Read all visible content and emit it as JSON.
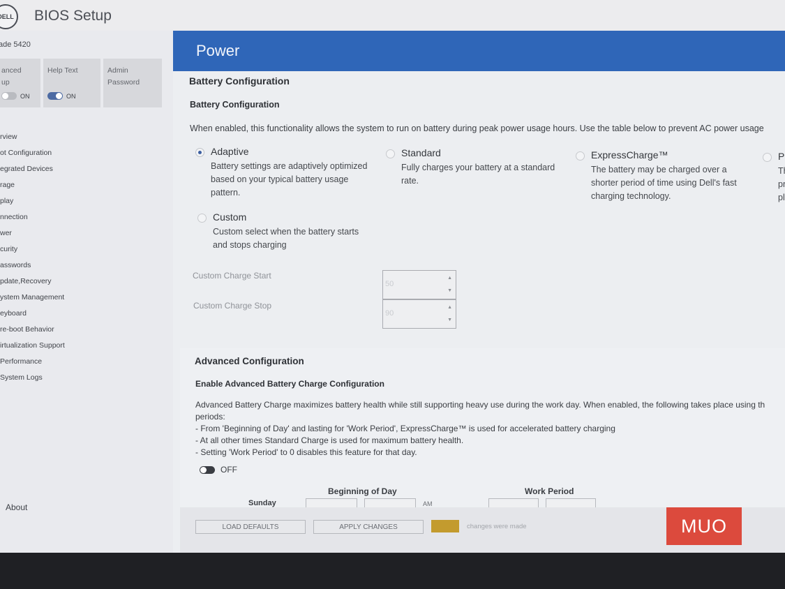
{
  "app": {
    "logo_text": "DELL",
    "title": "BIOS Setup",
    "model": "ade 5420"
  },
  "quick_settings": [
    {
      "label_lines": [
        "anced",
        "up"
      ],
      "toggle": "ON",
      "on": false
    },
    {
      "label_lines": [
        "Help Text",
        ""
      ],
      "toggle": "ON",
      "on": true
    },
    {
      "label_lines": [
        "Admin",
        "Password"
      ],
      "toggle": "",
      "on": false
    }
  ],
  "nav": [
    "rview",
    "ot Configuration",
    "egrated Devices",
    "rage",
    "play",
    "nnection",
    "wer",
    "curity",
    "asswords",
    "pdate,Recovery",
    "ystem Management",
    "eyboard",
    "re-boot Behavior",
    "irtualization Support",
    "Performance",
    "System Logs"
  ],
  "about": "About",
  "page": {
    "title": "Power"
  },
  "battery": {
    "section_title": "Battery Configuration",
    "sub_title": "Battery Configuration",
    "description": "When enabled, this functionality allows the system to run on battery during peak power usage hours. Use the table below to prevent AC power usage",
    "options": [
      {
        "name": "Adaptive",
        "desc": [
          "Battery settings are adaptively optimized",
          "based on your typical battery usage",
          "pattern."
        ],
        "selected": true
      },
      {
        "name": "Standard",
        "desc": [
          "Fully charges your battery at a standard",
          "rate."
        ],
        "selected": false
      },
      {
        "name": "ExpressCharge™",
        "desc": [
          "The battery may be charged over a",
          "shorter period of time using Dell's fast",
          "charging technology."
        ],
        "selected": false
      },
      {
        "name": "P",
        "desc": [
          "Th",
          "pr",
          "pl"
        ],
        "selected": false
      },
      {
        "name": "Custom",
        "desc": [
          "Custom select when the battery starts",
          "and stops charging"
        ],
        "selected": false
      }
    ],
    "custom_start_label": "Custom Charge Start",
    "custom_start_value": "50",
    "custom_stop_label": "Custom Charge Stop",
    "custom_stop_value": "90"
  },
  "advanced": {
    "section_title": "Advanced Configuration",
    "sub_title": "Enable Advanced Battery Charge Configuration",
    "description_lines": [
      "Advanced Battery Charge maximizes battery health while still supporting heavy use during the work day. When enabled, the following takes place using th",
      "periods:",
      "- From 'Beginning of Day' and lasting for 'Work Period', ExpressCharge™ is used for accelerated battery charging",
      "- At all other times Standard Charge is used for maximum battery health.",
      "- Setting 'Work Period' to 0 disables this feature for that day."
    ],
    "toggle_label": "OFF",
    "table_headers": {
      "beginning": "Beginning of Day",
      "work_period": "Work Period"
    },
    "first_row_day": "Sunday",
    "first_row_ampm": "AM"
  },
  "footer": {
    "load_defaults": "LOAD DEFAULTS",
    "apply_changes": "APPLY CHANGES",
    "status_text": "changes were made"
  },
  "watermark": "MUO",
  "colors": {
    "header_blue": "#2f66b8",
    "status_amber": "#c39b2e",
    "watermark_red": "#dc4a3d"
  }
}
